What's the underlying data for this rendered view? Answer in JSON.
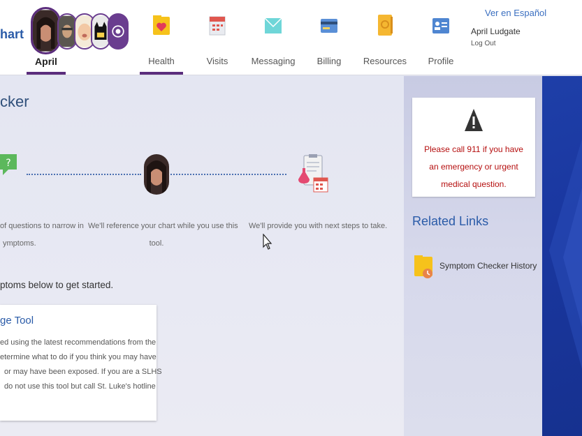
{
  "header": {
    "brand_text": "hart",
    "active_user": "April",
    "language_link": "Ver en Español",
    "user_name": "April Ludgate",
    "logout_label": "Log Out",
    "nav": [
      {
        "label": "Health",
        "icon": "heart-folder-icon",
        "active": true
      },
      {
        "label": "Visits",
        "icon": "calendar-icon",
        "active": false
      },
      {
        "label": "Messaging",
        "icon": "envelope-icon",
        "active": false
      },
      {
        "label": "Billing",
        "icon": "credit-card-icon",
        "active": false
      },
      {
        "label": "Resources",
        "icon": "book-icon",
        "active": false
      },
      {
        "label": "Profile",
        "icon": "id-card-icon",
        "active": false
      }
    ]
  },
  "main": {
    "title": "cker",
    "steps": [
      {
        "icon": "question-bubble-icon",
        "text_line1": "of questions to narrow in",
        "text_line2": "ymptoms."
      },
      {
        "icon": "patient-avatar-icon",
        "text_line1": "We'll reference your chart while you use this",
        "text_line2": "tool."
      },
      {
        "icon": "clipboard-lab-icon",
        "text_line1": "We'll provide you with next steps to take.",
        "text_line2": ""
      }
    ],
    "prompt": "ptoms below to get started.",
    "card": {
      "title": "ge Tool",
      "lines": [
        "ed using the latest recommendations from the",
        "etermine what to do if you think you may have",
        "or may have been exposed. If you are a SLHS",
        "do not use this tool but call St. Luke's hotline"
      ]
    }
  },
  "sidebar": {
    "alert_text": "Please call 911 if you have an emergency or urgent medical question.",
    "related_title": "Related Links",
    "history_link": "Symptom Checker History"
  },
  "colors": {
    "accent_purple": "#5b2d7d",
    "link_blue": "#2a5ba8",
    "alert_red": "#b50f0f",
    "panel_blue": "#1e3fa8"
  }
}
